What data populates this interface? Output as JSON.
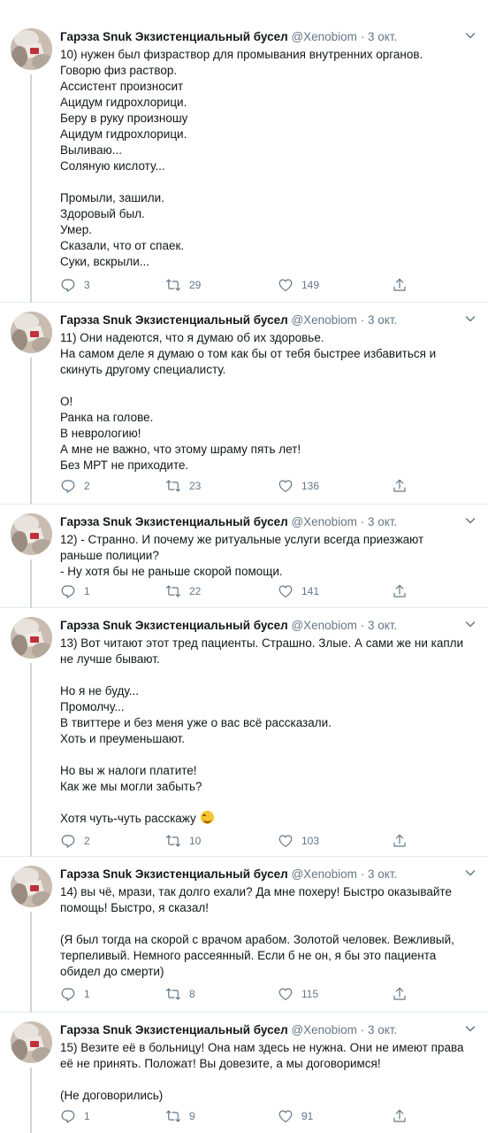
{
  "author": {
    "name": "Гарэза Snuk Экзистенциальный бусел",
    "handle": "@Xenobiom",
    "dot": "·",
    "date": "3 окт."
  },
  "icons": {
    "reply": "reply-icon",
    "retweet": "retweet-icon",
    "like": "heart-icon",
    "share": "share-icon",
    "more": "chevron-down-icon"
  },
  "colors": {
    "text": "#14171a",
    "muted": "#657786",
    "divider": "#e6ecf0"
  },
  "tweets": [
    {
      "lines": [
        "10) нужен был физраствор для промывания внутренних органов.",
        "Говорю физ раствор.",
        "Ассистент произносит",
        "Ацидум гидрохлорици.",
        "Беру в руку произношу",
        "Ацидум гидрохлорици.",
        "Выливаю...",
        "Соляную кислоту...",
        "",
        "Промыли, зашили.",
        "Здоровый был.",
        "Умер.",
        "Сказали, что от спаек.",
        "Суки, вскрыли..."
      ],
      "replies": "3",
      "retweets": "29",
      "likes": "149"
    },
    {
      "lines": [
        "11) Они надеются, что я думаю об их здоровье.",
        "На самом деле я думаю о том как бы от тебя быстрее избавиться и",
        "скинуть другому специалисту.",
        "",
        "О!",
        "Ранка на голове.",
        "В неврологию!",
        "А мне не важно, что этому шраму пять лет!",
        "Без МРТ не приходите."
      ],
      "replies": "2",
      "retweets": "23",
      "likes": "136"
    },
    {
      "lines": [
        "12) - Странно. И почему же ритуальные услуги всегда приезжают",
        "раньше полиции?",
        "- Ну хотя бы не раньше скорой помощи."
      ],
      "replies": "1",
      "retweets": "22",
      "likes": "141"
    },
    {
      "lines": [
        "13) Вот читают этот тред пациенты. Страшно. Злые. А сами же ни капли",
        "не лучше бывают.",
        "",
        "Но я не буду...",
        "Промолчу...",
        "В твиттере и без меня уже о вас всё рассказали.",
        "Хоть и преуменьшают.",
        "",
        "Но вы ж налоги платите!",
        "Как же мы могли забыть?",
        "",
        "Хотя чуть-чуть расскажу"
      ],
      "emoji": "smiling-face-emoji",
      "replies": "2",
      "retweets": "10",
      "likes": "103"
    },
    {
      "lines": [
        "14) вы чё, мрази, так долго ехали? Да мне похеру! Быстро оказывайте",
        "помощь! Быстро, я сказал!",
        "",
        "(Я был тогда на скорой с врачом арабом. Золотой человек. Вежливый,",
        "терпеливый. Немного рассеянный. Если б не он, я бы это пациента",
        "обидел до смерти)"
      ],
      "replies": "1",
      "retweets": "8",
      "likes": "115"
    },
    {
      "lines": [
        "15) Везите её в больницу! Она нам здесь не нужна. Они не имеют права",
        "её не принять. Положат! Вы довезите, а мы договоримся!",
        "",
        "(Не договорились)"
      ],
      "replies": "1",
      "retweets": "9",
      "likes": "91"
    }
  ]
}
